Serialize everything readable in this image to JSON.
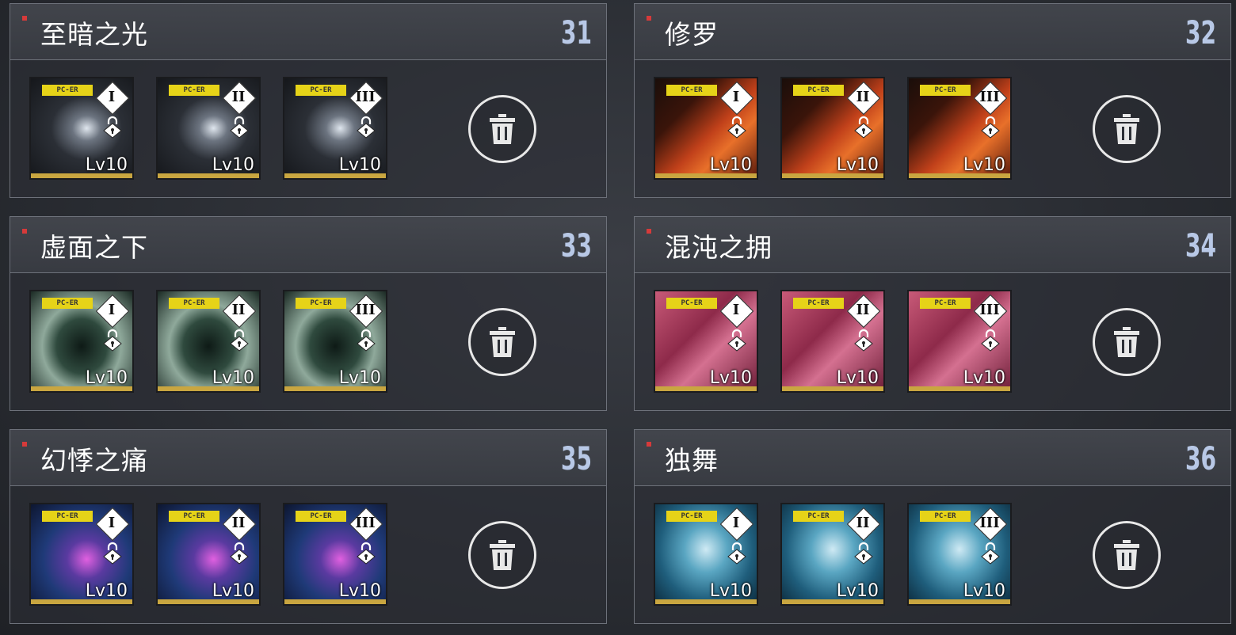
{
  "level_label": "Lv10",
  "tag_label": "PC-ER",
  "tiers": [
    "I",
    "II",
    "III"
  ],
  "panels": [
    {
      "title": "至暗之光",
      "number": "31",
      "theme": "light"
    },
    {
      "title": "修罗",
      "number": "32",
      "theme": "red"
    },
    {
      "title": "虚面之下",
      "number": "33",
      "theme": "green"
    },
    {
      "title": "混沌之拥",
      "number": "34",
      "theme": "pink"
    },
    {
      "title": "幻悸之痛",
      "number": "35",
      "theme": "blue"
    },
    {
      "title": "独舞",
      "number": "36",
      "theme": "cyan"
    }
  ],
  "colors": {
    "accent_number": "#b8c8e6",
    "marker": "#d63a3a",
    "tag": "#e6d318"
  },
  "icons": {
    "delete": "trash-icon",
    "lock": "lock-icon",
    "tier": "diamond-tier-icon"
  }
}
